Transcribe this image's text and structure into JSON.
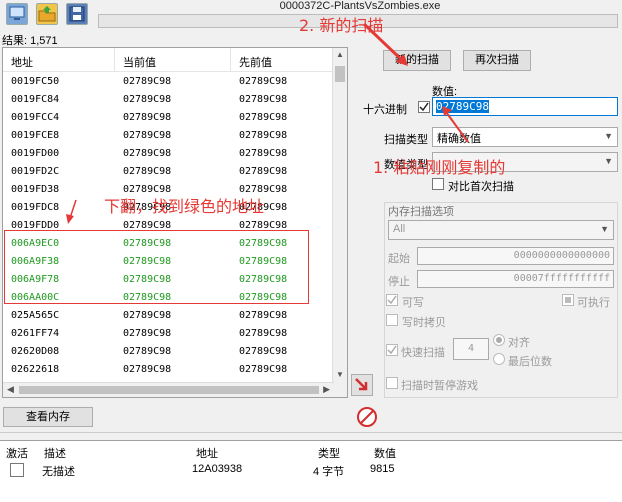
{
  "window": {
    "title": "0000372C-PlantsVsZombies.exe"
  },
  "toolbar": {
    "icons": [
      "computer-icon",
      "open-folder-icon",
      "save-icon"
    ]
  },
  "results": {
    "text": "结果: 1,571"
  },
  "list": {
    "headers": [
      "地址",
      "当前值",
      "先前值"
    ],
    "rows": [
      {
        "addr": "0019FC50",
        "cur": "02789C98",
        "prev": "02789C98",
        "green": false
      },
      {
        "addr": "0019FC84",
        "cur": "02789C98",
        "prev": "02789C98",
        "green": false
      },
      {
        "addr": "0019FCC4",
        "cur": "02789C98",
        "prev": "02789C98",
        "green": false
      },
      {
        "addr": "0019FCE8",
        "cur": "02789C98",
        "prev": "02789C98",
        "green": false
      },
      {
        "addr": "0019FD00",
        "cur": "02789C98",
        "prev": "02789C98",
        "green": false
      },
      {
        "addr": "0019FD2C",
        "cur": "02789C98",
        "prev": "02789C98",
        "green": false
      },
      {
        "addr": "0019FD38",
        "cur": "02789C98",
        "prev": "02789C98",
        "green": false
      },
      {
        "addr": "0019FDC8",
        "cur": "02789C98",
        "prev": "02789C98",
        "green": false
      },
      {
        "addr": "0019FDD0",
        "cur": "02789C98",
        "prev": "02789C98",
        "green": false
      },
      {
        "addr": "006A9EC0",
        "cur": "02789C98",
        "prev": "02789C98",
        "green": true
      },
      {
        "addr": "006A9F38",
        "cur": "02789C98",
        "prev": "02789C98",
        "green": true
      },
      {
        "addr": "006A9F78",
        "cur": "02789C98",
        "prev": "02789C98",
        "green": true
      },
      {
        "addr": "006AA00C",
        "cur": "02789C98",
        "prev": "02789C98",
        "green": true
      },
      {
        "addr": "025A565C",
        "cur": "02789C98",
        "prev": "02789C98",
        "green": false
      },
      {
        "addr": "0261FF74",
        "cur": "02789C98",
        "prev": "02789C98",
        "green": false
      },
      {
        "addr": "02620D08",
        "cur": "02789C98",
        "prev": "02789C98",
        "green": false
      },
      {
        "addr": "02622618",
        "cur": "02789C98",
        "prev": "02789C98",
        "green": false
      }
    ]
  },
  "buttons": {
    "new_scan": "新的扫描",
    "next_scan": "再次扫描",
    "memory_view": "查看内存"
  },
  "value": {
    "label": "数值:",
    "hex_label": "十六进制",
    "input": "02789C98"
  },
  "scan_type": {
    "label": "扫描类型",
    "selected": "精确数值"
  },
  "value_type": {
    "label": "数值类型"
  },
  "compare_first": "对比首次扫描",
  "mem_options": {
    "title": "内存扫描选项",
    "region": "All",
    "start_label": "起始",
    "start": "0000000000000000",
    "stop_label": "停止",
    "stop": "00007fffffffffff",
    "writable": "可写",
    "executable": "可执行",
    "copy_on_write": "写时拷贝",
    "fast_scan": "快速扫描",
    "fast_scan_value": "4",
    "align": "对齐",
    "last_digit": "最后位数",
    "pause_game": "扫描时暂停游戏"
  },
  "annotations": {
    "a1": "2. 新的扫描",
    "a2": "1. 粘贴刚刚复制的",
    "a3": "下翻，找到绿色的地址"
  },
  "bottom": {
    "headers": [
      "激活",
      "描述",
      "地址",
      "类型",
      "数值"
    ],
    "row": {
      "desc": "无描述",
      "addr": "12A03938",
      "type": "4 字节",
      "value": "9815"
    }
  },
  "colors": {
    "highlight": "#0078d7",
    "annotation": "#e53935",
    "green_text": "#1e9a1e"
  }
}
